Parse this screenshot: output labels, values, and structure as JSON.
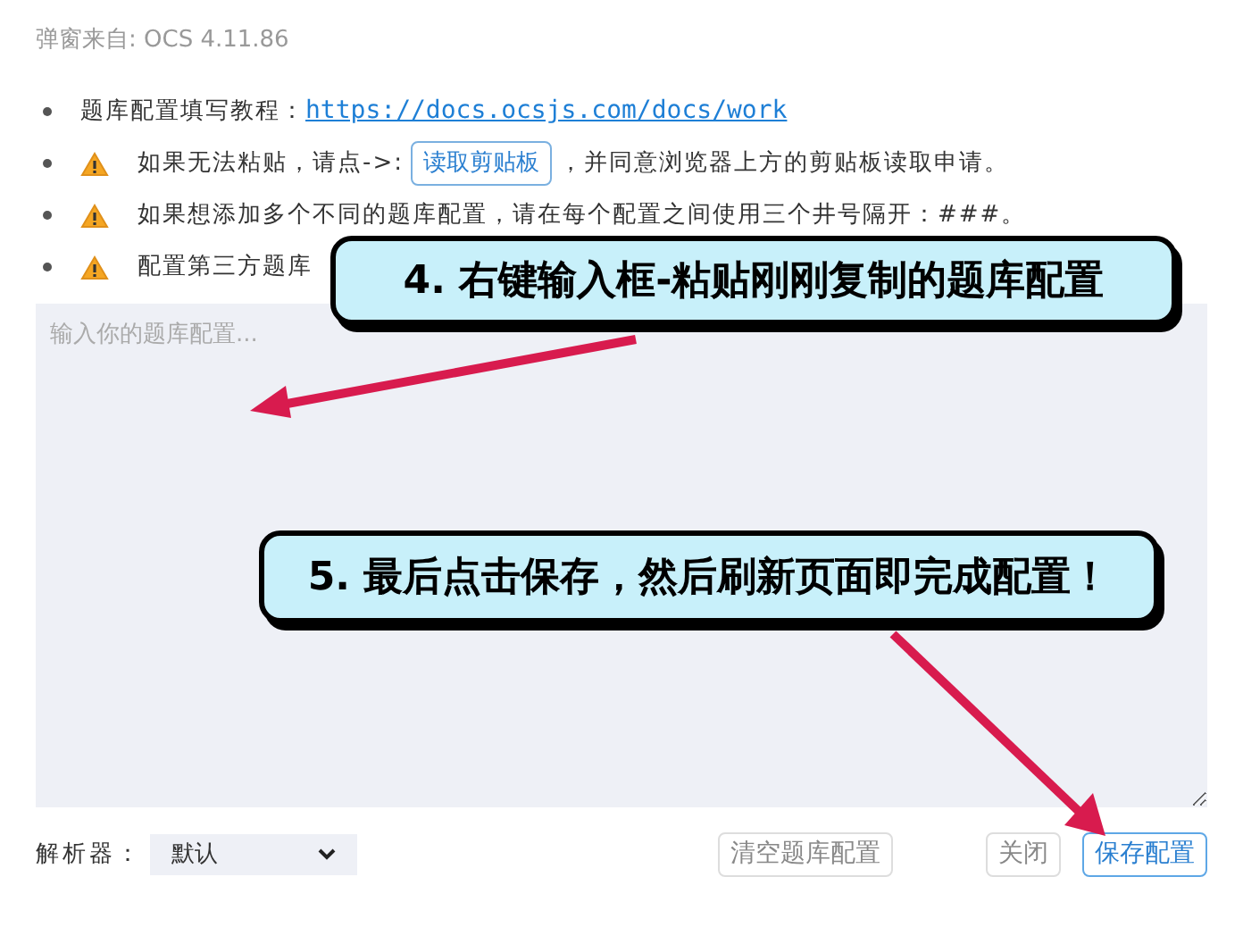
{
  "header": {
    "source": "弹窗来自: OCS 4.11.86"
  },
  "notes": [
    {
      "kind": "link",
      "text": "题库配置填写教程：",
      "link": "https://docs.ocsjs.com/docs/work"
    },
    {
      "kind": "button",
      "text": "如果无法粘贴，请点->:",
      "button": "读取剪贴板",
      "after": "，并同意浏览器上方的剪贴板读取申请。"
    },
    {
      "kind": "warning",
      "text": "如果想添加多个不同的题库配置，请在每个配置之间使用三个井号隔开：###。"
    },
    {
      "kind": "warning",
      "text": "配置第三方题库"
    }
  ],
  "config_input": {
    "placeholder": "输入你的题库配置..."
  },
  "parser": {
    "label": "解析器：",
    "value": "默认"
  },
  "buttons": [
    {
      "label": "清空题库配置",
      "primary": false
    },
    {
      "label": "关闭",
      "primary": false
    },
    {
      "label": "保存配置",
      "primary": true
    }
  ],
  "callouts": [
    {
      "text": "4. 右键输入框-粘贴刚刚复制的题库配置"
    },
    {
      "text": "5. 最后点击保存，然后刷新页面即完成配置！"
    }
  ]
}
